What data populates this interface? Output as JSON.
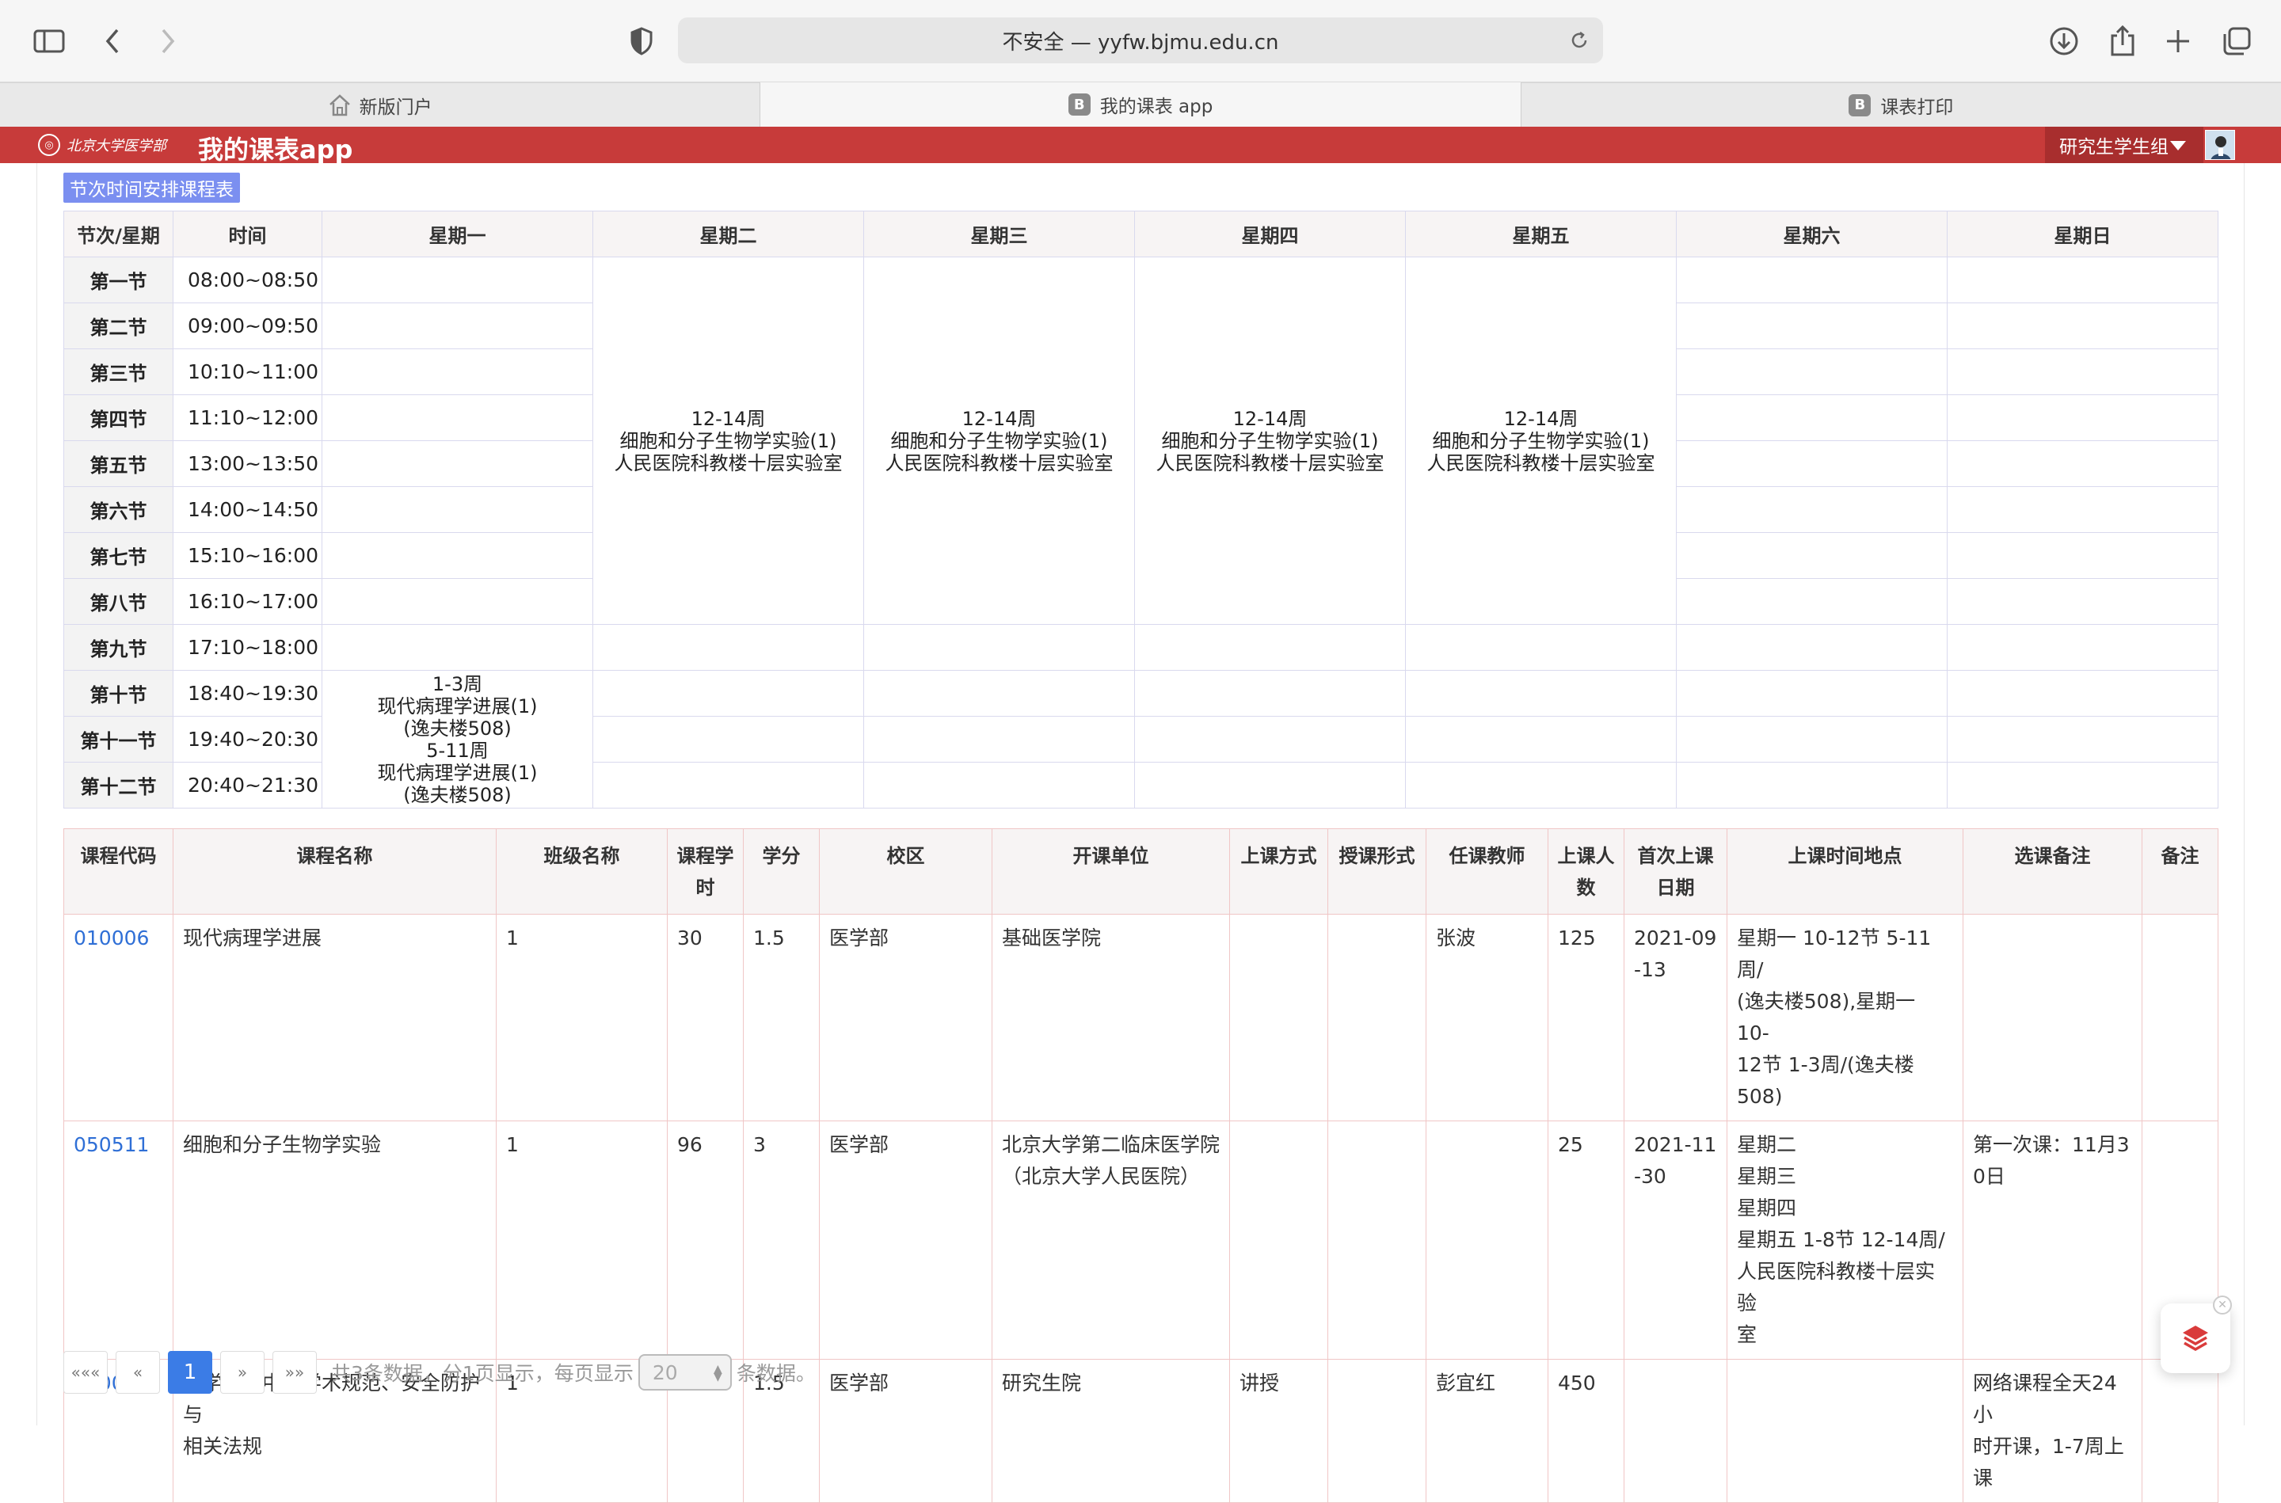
{
  "browser": {
    "url_text": "不安全 — yyfw.bjmu.edu.cn"
  },
  "tabs": [
    {
      "label": "新版门户",
      "icon": "home-icon"
    },
    {
      "label": "我的课表 app",
      "icon": "b-favicon",
      "badge": "B"
    },
    {
      "label": "课表打印",
      "icon": "b-favicon",
      "badge": "B"
    }
  ],
  "header": {
    "logo_text": "北京大学医学部",
    "app_title": "我的课表app",
    "group_select": "研究生学生组",
    "brand_color": "#c73b3a"
  },
  "schedule": {
    "section_label": "节次时间安排课程表",
    "headers": [
      "节次/星期",
      "时间",
      "星期一",
      "星期二",
      "星期三",
      "星期四",
      "星期五",
      "星期六",
      "星期日"
    ],
    "periods": [
      {
        "name": "第一节",
        "time": "08:00~08:50"
      },
      {
        "name": "第二节",
        "time": "09:00~09:50"
      },
      {
        "name": "第三节",
        "time": "10:10~11:00"
      },
      {
        "name": "第四节",
        "time": "11:10~12:00"
      },
      {
        "name": "第五节",
        "time": "13:00~13:50"
      },
      {
        "name": "第六节",
        "time": "14:00~14:50"
      },
      {
        "name": "第七节",
        "time": "15:10~16:00"
      },
      {
        "name": "第八节",
        "time": "16:10~17:00"
      },
      {
        "name": "第九节",
        "time": "17:10~18:00"
      },
      {
        "name": "第十节",
        "time": "18:40~19:30"
      },
      {
        "name": "第十一节",
        "time": "19:40~20:30"
      },
      {
        "name": "第十二节",
        "time": "20:40~21:30"
      }
    ],
    "lab_block": {
      "weeks": "12-14周",
      "course": "细胞和分子生物学实验(1)",
      "room": "人民医院科教楼十层实验室"
    },
    "monday_evening": {
      "line1": "1-3周",
      "line2": "现代病理学进展(1)",
      "line3": "(逸夫楼508)",
      "line4": "5-11周",
      "line5": "现代病理学进展(1)",
      "line6": "(逸夫楼508)"
    }
  },
  "courses": {
    "headers": {
      "code": "课程代码",
      "name": "课程名称",
      "class": "班级名称",
      "hours": "课程学时",
      "credit": "学分",
      "campus": "校区",
      "unit": "开课单位",
      "method": "上课方式",
      "form": "授课形式",
      "teacher": "任课教师",
      "count": "上课人数",
      "first": "首次上课日期",
      "time_place": "上课时间地点",
      "selection_note": "选课备注",
      "note": "备注"
    },
    "rows": [
      {
        "code": "010006",
        "name": "现代病理学进展",
        "class": "1",
        "hours": "30",
        "credit": "1.5",
        "campus": "医学部",
        "unit": "基础医学院",
        "method": "",
        "form": "",
        "teacher": "张波",
        "count": "125",
        "first_a": "2021-09",
        "first_b": "-13",
        "tp_lines": [
          "星期一 10-12节 5-11周/",
          "(逸夫楼508),星期一 10-",
          "12节 1-3周/(逸夫楼508)"
        ],
        "sel_lines": [],
        "note": ""
      },
      {
        "code": "050511",
        "name": "细胞和分子生物学实验",
        "class": "1",
        "hours": "96",
        "credit": "3",
        "campus": "医学部",
        "unit_lines": [
          "北京大学第二临床医学院",
          "（北京大学人民医院）"
        ],
        "method": "",
        "form": "",
        "teacher": "",
        "count": "25",
        "first_a": "2021-11",
        "first_b": "-30",
        "tp_lines": [
          "星期二",
          "星期三",
          "星期四",
          "星期五 1-8节 12-14周/",
          "人民医院科教楼十层实验",
          "室"
        ],
        "sel_lines": [
          "第一次课：11月3",
          "0日"
        ],
        "note": ""
      },
      {
        "code": "180002",
        "name_lines": [
          "医学研究中的学术规范、安全防护与",
          "相关法规"
        ],
        "class": "1",
        "hours": "32",
        "credit": "1.5",
        "campus": "医学部",
        "unit": "研究生院",
        "method": "讲授",
        "form": "",
        "teacher": "彭宜红",
        "count": "450",
        "first_a": "",
        "first_b": "",
        "tp_lines": [],
        "sel_lines": [
          "网络课程全天24小",
          "时开课，1-7周上",
          "课"
        ],
        "note": ""
      }
    ]
  },
  "pagination": {
    "first": "«««",
    "prev": "«",
    "current": "1",
    "next": "»",
    "last": "»»",
    "info_prefix": "共3条数据，分1页显示，每页显示",
    "page_size": "20",
    "info_suffix": "条数据。"
  }
}
